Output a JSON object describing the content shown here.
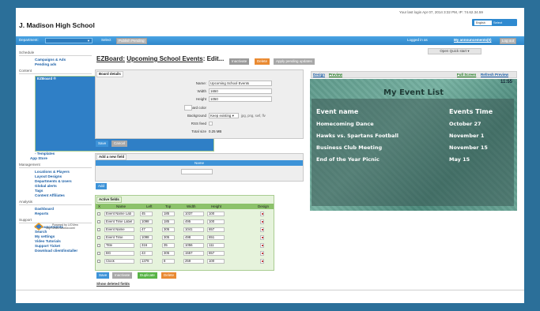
{
  "header": {
    "last_login": "Your last login Apr 07, 2014 3:32 PM, IP: 74.62.34.59",
    "site_title": "J. Madison High School",
    "lang_value": "English",
    "lang_select": "Select"
  },
  "topbar": {
    "department_label": "Department:",
    "select_label": "Select",
    "publish_label": "Publish Pending",
    "logged_in": "Logged in as",
    "announcements": "My announcements(0)",
    "logout": "Log out"
  },
  "sidebar": {
    "sections": [
      {
        "title": "Schedule",
        "items": [
          "Campaigns & Ads",
          "Pending ads"
        ]
      },
      {
        "title": "Content",
        "items": [
          "EZBoard ®",
          "- Templates",
          "App Store"
        ]
      },
      {
        "title": "Management",
        "items": [
          "Locations & Players",
          "Layout Designs",
          "Departments & Users",
          "Global alerts",
          "Tags",
          "Content Affiliates"
        ]
      },
      {
        "title": "Analysis",
        "items": [
          "Dashboard",
          "Reports"
        ]
      },
      {
        "title": "Support",
        "items": [
          "Announcements",
          "Search",
          "My settings",
          "Video Tutorials",
          "Support Ticket",
          "Download client/installer"
        ]
      }
    ],
    "powered_line1": "Powered by UCView",
    "powered_line2": "http://www.ucview.com/"
  },
  "main": {
    "title_prefix": "EZBoard:",
    "title_name": "Upcoming School Events",
    "title_suffix": ": Edit...",
    "inactivate": "Inactivate",
    "delete": "Delete",
    "apply": "Apply pending updates",
    "quick_start": "Open Quick start ▾"
  },
  "board_details": {
    "tab": "Board details",
    "name_label": "Name:",
    "name_value": "Upcoming School Events",
    "width_label": "Width",
    "width_value": "1650",
    "height_label": "Height",
    "height_value": "1050",
    "color_label": "Board color",
    "bg_label": "Background",
    "bg_value": "Keep existing ▾",
    "bg_hint": "jpg, png, swf, flv",
    "rss_label": "RSS feed",
    "size_label": "Total size",
    "size_value": "0.25 MB",
    "save": "Save",
    "cancel": "Cancel"
  },
  "add_field": {
    "tab": "Add a new field",
    "name_header": "Name",
    "add": "Add"
  },
  "active_fields": {
    "tab": "Active fields",
    "headers": [
      "X",
      "Name",
      "Left",
      "Top",
      "Width",
      "Height",
      "Design"
    ],
    "rows": [
      {
        "name": "Event Name Lab",
        "left": "45",
        "top": "185",
        "width": "1037",
        "height": "100"
      },
      {
        "name": "Event Time Label",
        "left": "1098",
        "top": "185",
        "width": "495",
        "height": "100"
      },
      {
        "name": "Event Name",
        "left": "47",
        "top": "305",
        "width": "1041",
        "height": "657"
      },
      {
        "name": "Event Time",
        "left": "1098",
        "top": "305",
        "width": "498",
        "height": "651"
      },
      {
        "name": "Title",
        "left": "316",
        "top": "35",
        "width": "1056",
        "height": "111"
      },
      {
        "name": "BG",
        "left": "43",
        "top": "305",
        "width": "1557",
        "height": "657"
      },
      {
        "name": "Clock",
        "left": "1378",
        "top": "8",
        "width": "259",
        "height": "100"
      }
    ],
    "save": "Save",
    "inactivate": "Inactivate",
    "duplicate": "Duplicate",
    "delete": "Delete",
    "show_deleted": "Show deleted fields"
  },
  "preview": {
    "design_link": "Design",
    "preview_link": "Preview",
    "fullscreen": "Full Screen",
    "refresh": "Refresh Preview",
    "clock": "11:55",
    "title": "My Event List",
    "col_name": "Event name",
    "col_time": "Events Time",
    "events": [
      {
        "name": "Homecoming Dance",
        "time": "October 27"
      },
      {
        "name": "Hawks vs. Spartans Football",
        "time": "November 1"
      },
      {
        "name": "Business Club Meeting",
        "time": "November  15"
      },
      {
        "name": "End of the Year Picnic",
        "time": "May 15"
      }
    ]
  }
}
